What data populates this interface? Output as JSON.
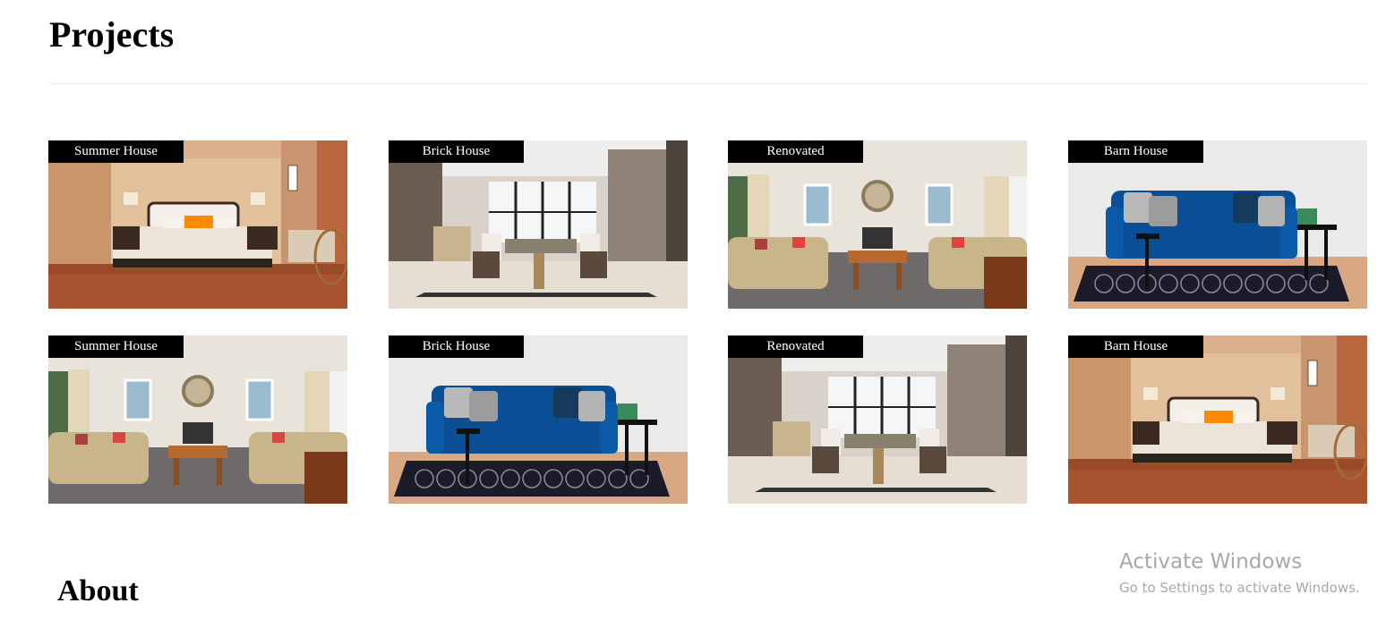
{
  "page": {
    "title": "Projects",
    "about_title": "About"
  },
  "projects": {
    "cards": [
      {
        "label": "Summer House",
        "image": "bedroom"
      },
      {
        "label": "Brick House",
        "image": "dining-room"
      },
      {
        "label": "Renovated",
        "image": "living-room"
      },
      {
        "label": "Barn House",
        "image": "blue-sofa"
      },
      {
        "label": "Summer House",
        "image": "living-room"
      },
      {
        "label": "Brick House",
        "image": "blue-sofa"
      },
      {
        "label": "Renovated",
        "image": "dining-room"
      },
      {
        "label": "Barn House",
        "image": "bedroom"
      }
    ]
  },
  "watermark": {
    "title": "Activate Windows",
    "subtitle": "Go to Settings to activate Windows."
  },
  "colors": {
    "label_bg": "#000000",
    "label_text": "#ffffff",
    "divider": "#e9e9e9",
    "watermark": "#a8a8a8",
    "sofa_blue": "#0a4f96",
    "floor_wood": "#9a4a28"
  }
}
